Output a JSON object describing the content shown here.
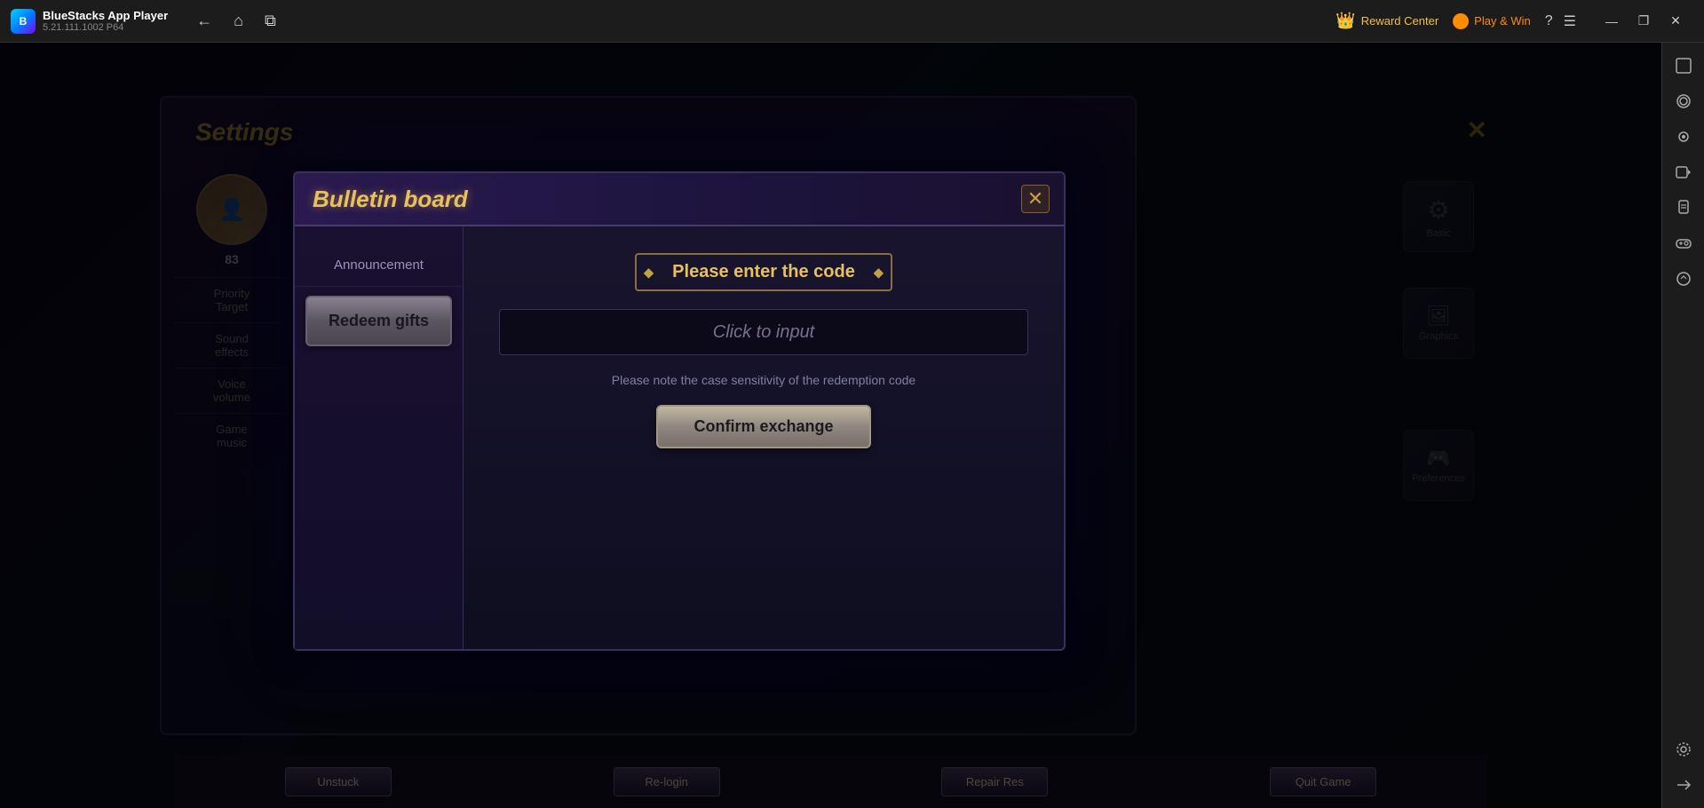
{
  "app": {
    "name": "BlueStacks App Player",
    "version": "5.21.111.1002  P64",
    "logo_letter": "B"
  },
  "topbar": {
    "reward_center_label": "Reward Center",
    "play_win_label": "Play & Win",
    "nav": {
      "back": "←",
      "home": "⌂",
      "multi": "⧉"
    }
  },
  "window_controls": {
    "help": "?",
    "menu": "☰",
    "minimize": "—",
    "restore": "❐",
    "close": "✕"
  },
  "right_sidebar": {
    "tools": [
      {
        "name": "screenshot",
        "icon": "⊡"
      },
      {
        "name": "camera",
        "icon": "◎"
      },
      {
        "name": "record",
        "icon": "⊙"
      },
      {
        "name": "apk",
        "icon": "⬡"
      },
      {
        "name": "game-controls",
        "icon": "◈"
      },
      {
        "name": "macro",
        "icon": "⧖"
      },
      {
        "name": "more",
        "icon": "⋯"
      }
    ]
  },
  "settings": {
    "title": "Settings",
    "close": "✕",
    "avatar_level": "83",
    "menu_items": [
      "Priority\nTarget",
      "Sound\neffects",
      "Voice\nvolume",
      "Game\nmusic"
    ],
    "right_labels": [
      "Basic",
      "Graphics",
      "Preferences"
    ],
    "bottom_buttons": [
      "Unstuck",
      "Re-login",
      "Repair Res",
      "Quit Game"
    ]
  },
  "bulletin_board": {
    "title": "Bulletin board",
    "close": "✕",
    "tabs": {
      "announcement": "Announcement",
      "redeem": "Redeem gifts"
    },
    "code_section": {
      "title": "Please enter the code",
      "input_placeholder": "Click to input",
      "hint": "Please note the case sensitivity of the redemption code",
      "confirm_button": "Confirm exchange"
    }
  }
}
